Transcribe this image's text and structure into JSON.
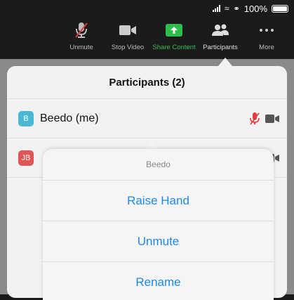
{
  "status_bar": {
    "battery_text": "100%"
  },
  "toolbar": {
    "items": [
      {
        "label": "Unmute",
        "icon": "mic-muted-icon"
      },
      {
        "label": "Stop Video",
        "icon": "video-camera-icon"
      },
      {
        "label": "Share Content",
        "icon": "share-screen-icon"
      },
      {
        "label": "Participants",
        "icon": "participants-icon"
      },
      {
        "label": "More",
        "icon": "more-icon"
      }
    ],
    "colors": {
      "share": "#2fbd4d",
      "muted": "#e23b3b"
    }
  },
  "panel": {
    "title": "Participants (2)",
    "participants": [
      {
        "initials": "B",
        "name": "Beedo (me)",
        "avatar_color": "#4ab8d4"
      },
      {
        "initials": "JB",
        "name": "",
        "avatar_color": "#e05555"
      }
    ]
  },
  "action_sheet": {
    "title": "Beedo",
    "items": [
      "Raise Hand",
      "Unmute",
      "Rename"
    ]
  }
}
